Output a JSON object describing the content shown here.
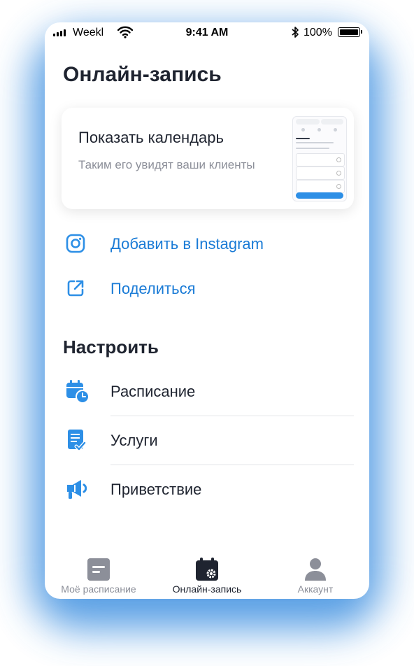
{
  "status_bar": {
    "carrier": "Weekl",
    "time": "9:41 AM",
    "battery": "100%"
  },
  "page_title": "Онлайн-запись",
  "calendar_card": {
    "title": "Показать календарь",
    "subtitle": "Таким его увидят ваши клиенты"
  },
  "actions": [
    {
      "label": "Добавить в Instagram",
      "icon": "instagram-icon"
    },
    {
      "label": "Поделиться",
      "icon": "share-icon"
    }
  ],
  "settings": {
    "title": "Настроить",
    "items": [
      {
        "label": "Расписание",
        "icon": "calendar-clock-icon"
      },
      {
        "label": "Услуги",
        "icon": "document-check-icon"
      },
      {
        "label": "Приветствие",
        "icon": "megaphone-icon"
      }
    ]
  },
  "tab_bar": {
    "tabs": [
      {
        "label": "Моё расписание",
        "icon": "note-icon",
        "active": false
      },
      {
        "label": "Онлайн-запись",
        "icon": "calendar-gear-icon",
        "active": true
      },
      {
        "label": "Аккаунт",
        "icon": "user-icon",
        "active": false
      }
    ]
  },
  "colors": {
    "accent": "#1a7bd6",
    "icon_blue": "#2d8fe6",
    "text_dark": "#1f2430",
    "text_muted": "#8c8f99",
    "glow": "#3d8fe0"
  }
}
